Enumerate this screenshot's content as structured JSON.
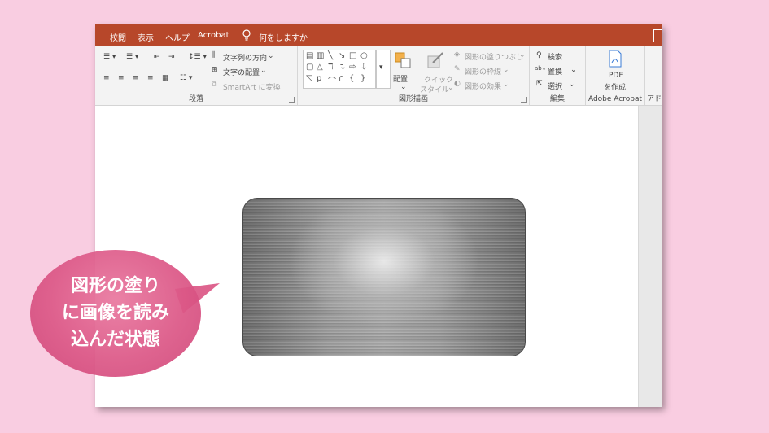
{
  "menu": {
    "items": [
      "校閲",
      "表示",
      "ヘルプ",
      "Acrobat"
    ],
    "tell_me": "何をしますか"
  },
  "ribbon": {
    "paragraph": {
      "text_direction": "文字列の方向",
      "align_text": "文字の配置",
      "smartart": "SmartArt に変換",
      "label": "段落"
    },
    "drawing": {
      "arrange": "配置",
      "quick_styles_1": "クイック",
      "quick_styles_2": "スタイル",
      "shape_fill": "図形の塗りつぶし",
      "shape_outline": "図形の枠線",
      "shape_effects": "図形の効果",
      "label": "図形描画"
    },
    "editing": {
      "find": "検索",
      "replace": "置換",
      "select": "選択",
      "label": "編集"
    },
    "acrobat": {
      "pdf_1": "PDF",
      "pdf_2": "を作成",
      "label": "Adobe Acrobat"
    },
    "partial_label": "アド"
  },
  "callout": {
    "line1": "図形の塗り",
    "line2": "に画像を読み",
    "line3": "込んだ状態"
  },
  "colors": {
    "background": "#f9cde1",
    "menubar": "#b7472a",
    "callout": "#dc5887"
  }
}
